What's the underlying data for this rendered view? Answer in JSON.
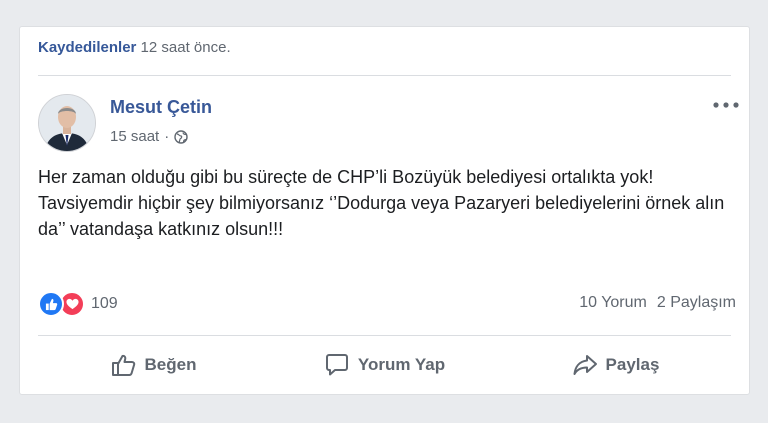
{
  "saved": {
    "link": "Kaydedilenler",
    "time": "12 saat önce."
  },
  "post": {
    "author": "Mesut Çetin",
    "time": "15 saat",
    "separator": "·",
    "audience_icon": "globe-icon",
    "text_lines": [
      "Her zaman olduğu gibi bu süreçte de CHP’li Bozüyük belediyesi ortalıkta yok!",
      "Tavsiyemdir hiçbir şey bilmiyorsanız ‘’Dodurga veya Pazaryeri belediyelerini örnek alın da’’ vatandaşa katkınız olsun!!!"
    ]
  },
  "reactions": {
    "count": "109",
    "types": [
      "like-icon",
      "love-icon"
    ]
  },
  "stats": {
    "comments": "10 Yorum",
    "shares": "2 Paylaşım"
  },
  "actions": {
    "like": "Beğen",
    "comment": "Yorum Yap",
    "share": "Paylaş"
  },
  "colors": {
    "link": "#385898",
    "like_blue": "#2078f4",
    "love_red": "#f33e58",
    "muted_text": "#606770"
  }
}
